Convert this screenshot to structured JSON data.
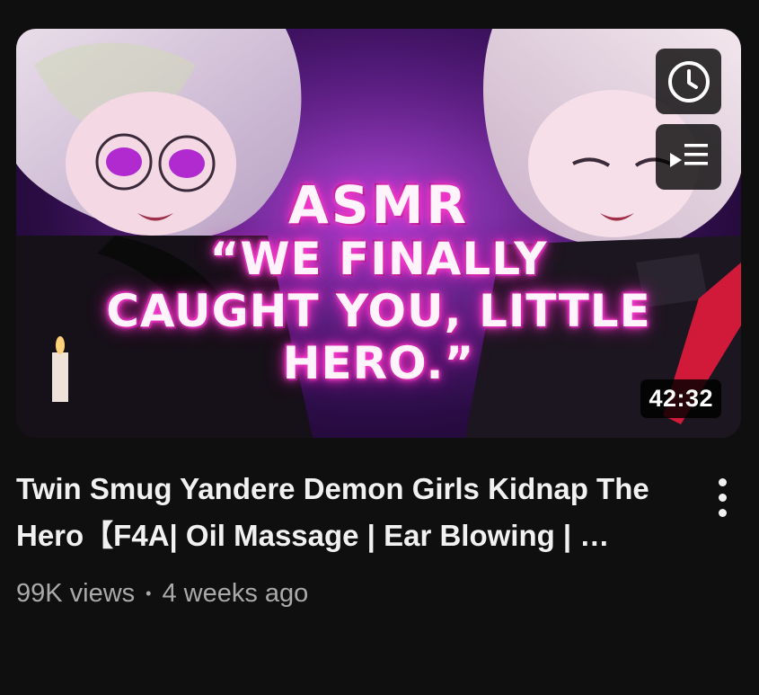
{
  "thumbnail": {
    "overlay_line1": "ASMR",
    "overlay_line2": "“WE FINALLY",
    "overlay_line3": "CAUGHT YOU, LITTLE",
    "overlay_line4": "HERO.”",
    "duration": "42:32",
    "watch_later_icon": "clock-icon",
    "add_to_queue_icon": "queue-icon"
  },
  "video": {
    "title": "Twin Smug Yandere Demon Girls Kidnap The Hero【F4A| Oil Massage | Ear Blowing | …",
    "views": "99K views",
    "separator": "•",
    "age": "4 weeks ago"
  },
  "menu": {
    "icon": "more-vertical-icon"
  },
  "colors": {
    "background": "#0f0f0f",
    "title_text": "#f1f1f1",
    "meta_text": "#aaaaaa",
    "neon_pink": "#ff3fd2"
  }
}
